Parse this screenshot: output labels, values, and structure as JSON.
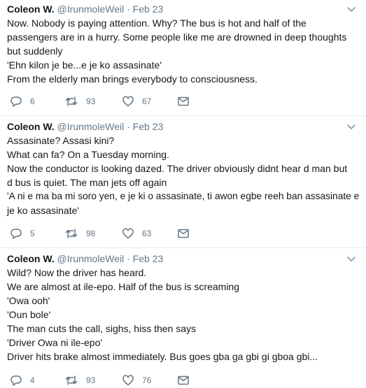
{
  "tweets": [
    {
      "author": "Coleon W.",
      "handle": "@IrunmoleWeil",
      "separator": "·",
      "time": "Feb 23",
      "lines": [
        "Now. Nobody is paying attention. Why? The bus is hot and half of the",
        "passengers are in a hurry. Some people like me are drowned in deep thoughts",
        "but suddenly",
        "'Ehn kilon je be...e je ko assasinate'",
        "From the elderly man brings everybody to consciousness."
      ],
      "replies": "6",
      "retweets": "93",
      "likes": "67"
    },
    {
      "author": "Coleon W.",
      "handle": "@IrunmoleWeil",
      "separator": "·",
      "time": "Feb 23",
      "lines": [
        "Assasinate? Assasi kini?",
        "What can fa? On a Tuesday morning.",
        "Now the conductor is looking dazed. The driver obviously didnt hear d man but",
        "d bus is quiet.  The man jets off again",
        "'A ni e ma ba mi soro yen, e je ki o assasinate, ti awon egbe reeh ban assasinate e",
        "je ko assasinate'"
      ],
      "replies": "5",
      "retweets": "98",
      "likes": "63"
    },
    {
      "author": "Coleon W.",
      "handle": "@IrunmoleWeil",
      "separator": "·",
      "time": "Feb 23",
      "lines": [
        "Wild? Now the driver has heard.",
        "We are almost at ile-epo. Half of the bus is screaming",
        "'Owa ooh'",
        "'Oun bole'",
        "The man cuts the call, sighs, hiss then says",
        "'Driver Owa ni ile-epo'",
        "Driver hits brake almost immediately. Bus goes gba ga gbi gi gboa gbi..."
      ],
      "replies": "4",
      "retweets": "93",
      "likes": "76"
    }
  ],
  "colors": {
    "text": "#14171a",
    "muted": "#657786",
    "divider": "#e6ecf0"
  },
  "icons": [
    "reply-icon",
    "retweet-icon",
    "like-icon",
    "message-icon",
    "chevron-down-icon"
  ]
}
